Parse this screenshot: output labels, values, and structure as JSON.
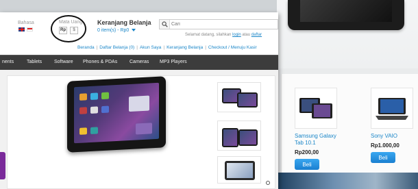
{
  "header": {
    "language_label": "Bahasa",
    "currency_label": "Mata Uang",
    "currency_options": [
      "Rp",
      "$"
    ],
    "cart_title": "Keranjang Belanja",
    "cart_summary": "0 item(s) - Rp0",
    "search_placeholder": "Cari",
    "welcome_prefix": "Selamat datang, silahkan",
    "welcome_login": "login",
    "welcome_or": "atau",
    "welcome_register": "daftar"
  },
  "top_links": [
    "Beranda",
    "Daftar Belanja (0)",
    "Akun Saya",
    "Keranjang Belanja",
    "Checkout / Menuju Kasir"
  ],
  "nav": [
    "nents",
    "Tablets",
    "Software",
    "Phones & PDAs",
    "Cameras",
    "MP3 Players"
  ],
  "products": [
    {
      "name": "Samsung Galaxy Tab 10.1",
      "price": "Rp200,00",
      "button": "Beli"
    },
    {
      "name": "Sony VAIO",
      "price": "Rp1.000,00",
      "button": "Beli"
    }
  ],
  "colors": {
    "link": "#1a86c8",
    "nav_bg": "#3c3c3c",
    "button": "#1a7fd0",
    "accent_tab": "#7a2a9a"
  }
}
